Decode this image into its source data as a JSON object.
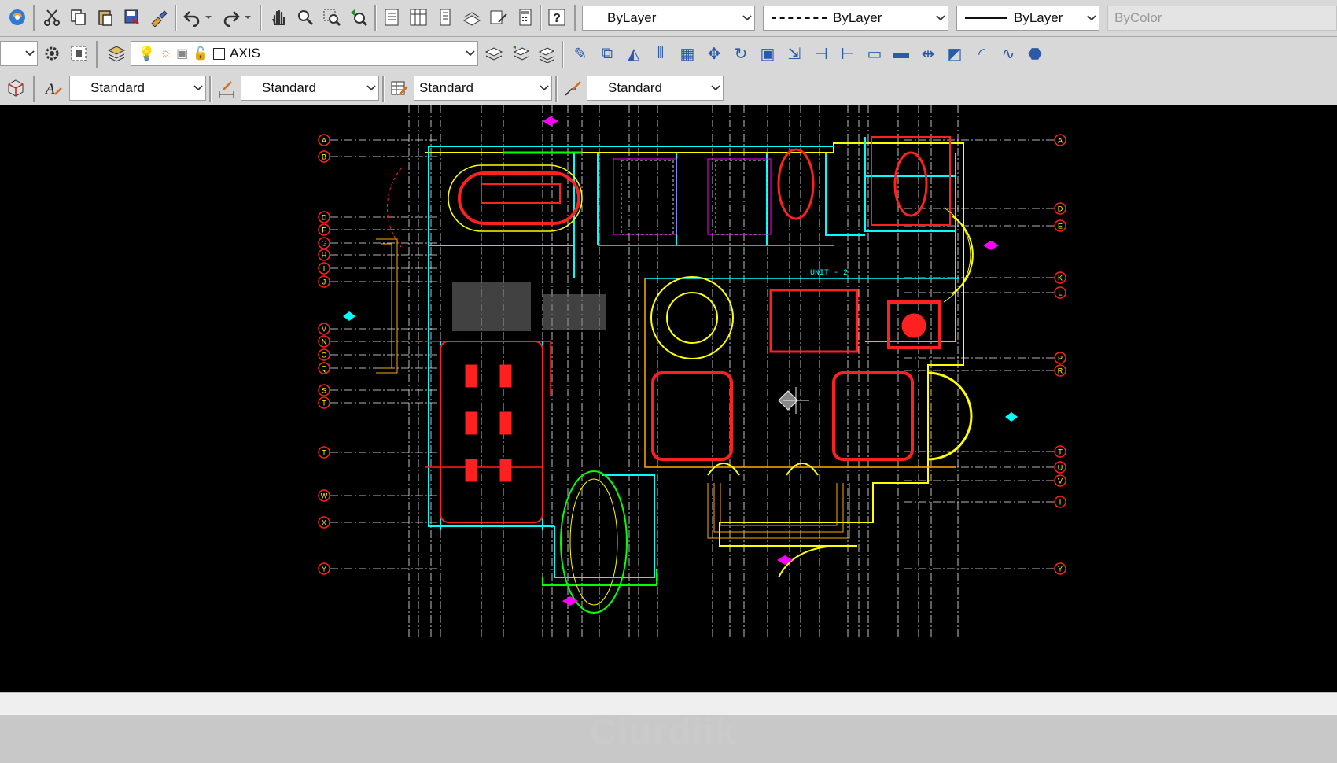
{
  "toolbar1": {
    "buttons": [
      "app-icon",
      "cut-icon",
      "copy-icon",
      "paste-icon",
      "save-as-icon",
      "match-properties-icon",
      "undo-icon",
      "undo-dropdown-icon",
      "redo-icon",
      "redo-dropdown-icon",
      "pan-hand-icon",
      "zoom-realtime-icon",
      "zoom-window-icon",
      "zoom-previous-icon",
      "properties-icon",
      "design-center-icon",
      "tool-palettes-icon",
      "sheet-set-icon",
      "markup-icon",
      "calculator-icon",
      "help-icon"
    ],
    "color_combo": "ByLayer",
    "linetype_combo": "ByLayer",
    "lineweight_combo": "ByLayer",
    "plotstyle_combo": "ByColor"
  },
  "toolbar2": {
    "layer_combo": "AXIS",
    "modify_tools": [
      "erase-icon",
      "copy-object-icon",
      "mirror-icon",
      "offset-icon",
      "array-icon",
      "move-icon",
      "rotate-icon",
      "scale-icon",
      "stretch-icon",
      "trim-icon",
      "extend-icon",
      "break-icon",
      "break-at-point-icon",
      "join-icon",
      "chamfer-icon",
      "fillet-icon",
      "blend-icon",
      "explode-icon"
    ]
  },
  "toolbar3": {
    "text_style": "Standard",
    "dim_style": "Standard",
    "table_style": "Standard",
    "mleader_style": "Standard"
  },
  "drawing": {
    "unit_label": "UNIT - 2",
    "grid_left": [
      "A",
      "B",
      "D",
      "F",
      "G",
      "H",
      "I",
      "J",
      "M",
      "N",
      "O",
      "Q",
      "S",
      "T",
      "T",
      "W",
      "X",
      "Y"
    ],
    "grid_right": [
      "A",
      "D",
      "E",
      "K",
      "L",
      "P",
      "R",
      "T",
      "U",
      "V",
      "I",
      "Y"
    ],
    "colors": {
      "red": "#ff2020",
      "yellow": "#ffff00",
      "cyan": "#00ffff",
      "green": "#00ff00",
      "magenta": "#ff00ff",
      "white": "#ffffff",
      "orange": "#ffaa00"
    }
  },
  "watermark": "Ciurdiik"
}
